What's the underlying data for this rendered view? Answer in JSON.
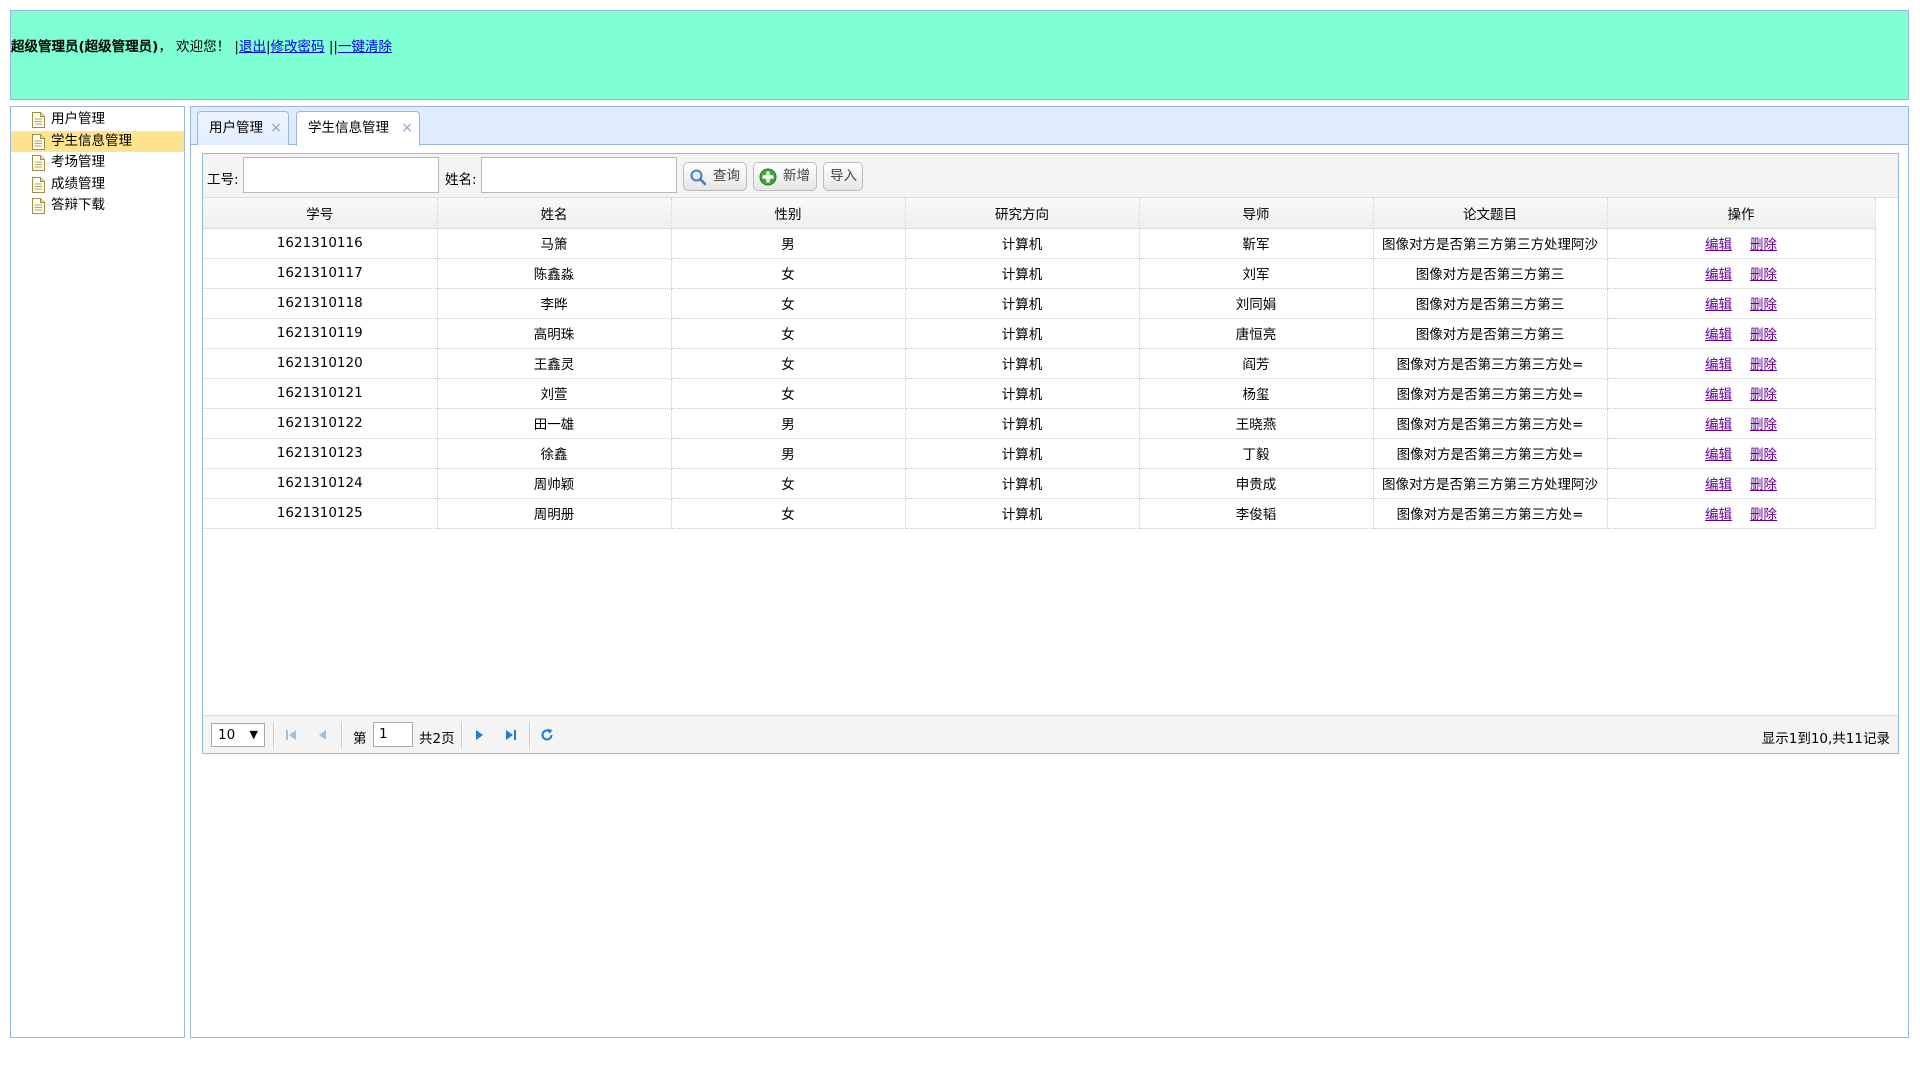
{
  "header": {
    "user_label": "超级管理员(超级管理员)",
    "welcome": "，  欢迎您！ |",
    "logout": "退出",
    "sep1": "|",
    "change_password": "修改密码",
    "sep2": " |",
    "clear_all": "一键清除",
    "bg_color": "#7fffd4"
  },
  "sidebar": {
    "items": [
      {
        "label": "用户管理",
        "icon": "file-icon"
      },
      {
        "label": "学生信息管理",
        "icon": "file-icon",
        "selected": true
      },
      {
        "label": "考场管理",
        "icon": "file-icon"
      },
      {
        "label": "成绩管理",
        "icon": "file-icon"
      },
      {
        "label": "答辩下载",
        "icon": "file-icon"
      }
    ]
  },
  "tabs": [
    {
      "label": "用户管理",
      "close": "×"
    },
    {
      "label": "学生信息管理",
      "close": "×",
      "active": true
    }
  ],
  "toolbar": {
    "id_label": "工号:",
    "id_value": "",
    "name_label": "姓名:",
    "name_value": "",
    "search_label": "查询",
    "add_label": "新增",
    "import_label": "导入"
  },
  "table": {
    "columns": [
      "学号",
      "姓名",
      "性别",
      "研究方向",
      "导师",
      "论文题目",
      "操作"
    ],
    "action_edit": "编辑",
    "action_delete": "删除",
    "rows": [
      [
        "1621310116",
        "马箫",
        "男",
        "计算机",
        "靳军",
        "图像对方是否第三方第三方处理阿沙"
      ],
      [
        "1621310117",
        "陈鑫淼",
        "女",
        "计算机",
        "刘军",
        "图像对方是否第三方第三"
      ],
      [
        "1621310118",
        "李晔",
        "女",
        "计算机",
        "刘同娟",
        "图像对方是否第三方第三"
      ],
      [
        "1621310119",
        "高明珠",
        "女",
        "计算机",
        "唐恒亮",
        "图像对方是否第三方第三"
      ],
      [
        "1621310120",
        "王鑫灵",
        "女",
        "计算机",
        "阎芳",
        "图像对方是否第三方第三方处="
      ],
      [
        "1621310121",
        "刘萱",
        "女",
        "计算机",
        "杨玺",
        "图像对方是否第三方第三方处="
      ],
      [
        "1621310122",
        "田一雄",
        "男",
        "计算机",
        "王晓燕",
        "图像对方是否第三方第三方处="
      ],
      [
        "1621310123",
        "徐鑫",
        "男",
        "计算机",
        "丁毅",
        "图像对方是否第三方第三方处="
      ],
      [
        "1621310124",
        "周帅颖",
        "女",
        "计算机",
        "申贵成",
        "图像对方是否第三方第三方处理阿沙"
      ],
      [
        "1621310125",
        "周明册",
        "女",
        "计算机",
        "李俊韬",
        "图像对方是否第三方第三方处="
      ]
    ]
  },
  "pager": {
    "page_size": "10",
    "page_prefix": "第",
    "page_number": "1",
    "page_total": "共2页",
    "info": "显示1到10,共11记录"
  }
}
